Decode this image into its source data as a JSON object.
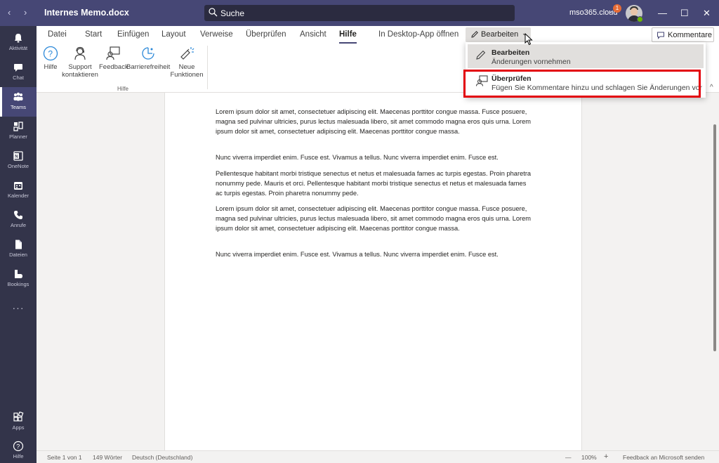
{
  "titlebar": {
    "doc_title": "Internes Memo.docx",
    "search_placeholder": "Suche",
    "tenant": "mso365.cloud",
    "notification_count": "1",
    "back_glyph": "‹",
    "forward_glyph": "›",
    "more_glyph": "···",
    "minimize_glyph": "—",
    "maximize_glyph": "☐",
    "close_glyph": "✕"
  },
  "rail": {
    "items": [
      {
        "label": "Aktivität",
        "icon": "bell-icon"
      },
      {
        "label": "Chat",
        "icon": "chat-icon"
      },
      {
        "label": "Teams",
        "icon": "teams-icon"
      },
      {
        "label": "Planner",
        "icon": "planner-icon"
      },
      {
        "label": "OneNote",
        "icon": "onenote-icon"
      },
      {
        "label": "Kalender",
        "icon": "calendar-icon"
      },
      {
        "label": "Anrufe",
        "icon": "phone-icon"
      },
      {
        "label": "Dateien",
        "icon": "file-icon"
      },
      {
        "label": "Bookings",
        "icon": "bookings-icon"
      },
      {
        "label": "Apps",
        "icon": "apps-icon"
      },
      {
        "label": "Hilfe",
        "icon": "help-icon"
      }
    ],
    "more_glyph": "···"
  },
  "ribbon": {
    "tabs": [
      "Datei",
      "Start",
      "Einfügen",
      "Layout",
      "Verweise",
      "Überprüfen",
      "Ansicht",
      "Hilfe",
      "In Desktop-App öffnen"
    ],
    "active_tab": "Hilfe",
    "edit_button": "Bearbeiten",
    "comment_button": "Kommentare",
    "buttons": [
      {
        "line1": "Hilfe",
        "line2": "",
        "icon": "help-circle-icon"
      },
      {
        "line1": "Support",
        "line2": "kontaktieren",
        "icon": "support-icon"
      },
      {
        "line1": "Feedback",
        "line2": "",
        "icon": "feedback-icon"
      },
      {
        "line1": "Barrierefreiheit",
        "line2": "",
        "icon": "accessibility-icon"
      },
      {
        "line1": "Neue",
        "line2": "Funktionen",
        "icon": "new-features-icon"
      }
    ],
    "group_label": "Hilfe",
    "collapse_glyph": "^"
  },
  "dropdown": {
    "items": [
      {
        "title": "Bearbeiten",
        "subtitle": "Änderungen vornehmen",
        "icon": "pencil-icon"
      },
      {
        "title": "Überprüfen",
        "subtitle": "Fügen Sie Kommentare hinzu und schlagen Sie Änderungen vor",
        "icon": "review-icon"
      }
    ]
  },
  "document": {
    "paragraphs": [
      "Lorem ipsum dolor sit amet, consectetuer adipiscing elit. Maecenas porttitor congue massa. Fusce posuere, magna sed pulvinar ultricies, purus lectus malesuada libero, sit amet commodo magna eros quis urna. Lorem ipsum dolor sit amet, consectetuer adipiscing elit. Maecenas porttitor congue massa.",
      "Nunc viverra imperdiet enim. Fusce est. Vivamus a tellus. Nunc viverra imperdiet enim. Fusce est.",
      "Pellentesque habitant morbi tristique senectus et netus et malesuada fames ac turpis egestas. Proin pharetra nonummy pede. Mauris et orci. Pellentesque habitant morbi tristique senectus et netus et malesuada fames ac turpis egestas. Proin pharetra nonummy pede.",
      "Lorem ipsum dolor sit amet, consectetuer adipiscing elit. Maecenas porttitor congue massa. Fusce posuere, magna sed pulvinar ultricies, purus lectus malesuada libero, sit amet commodo magna eros quis urna. Lorem ipsum dolor sit amet, consectetuer adipiscing elit. Maecenas porttitor congue massa.",
      "Nunc viverra imperdiet enim. Fusce est. Vivamus a tellus. Nunc viverra imperdiet enim. Fusce est."
    ]
  },
  "status": {
    "page": "Seite 1 von 1",
    "words": "149 Wörter",
    "language": "Deutsch (Deutschland)",
    "zoom_out": "—",
    "zoom": "100%",
    "zoom_in": "+",
    "feedback": "Feedback an Microsoft senden"
  },
  "colors": {
    "titlebar": "#464775",
    "rail": "#33344a",
    "highlight": "#e3000b"
  }
}
